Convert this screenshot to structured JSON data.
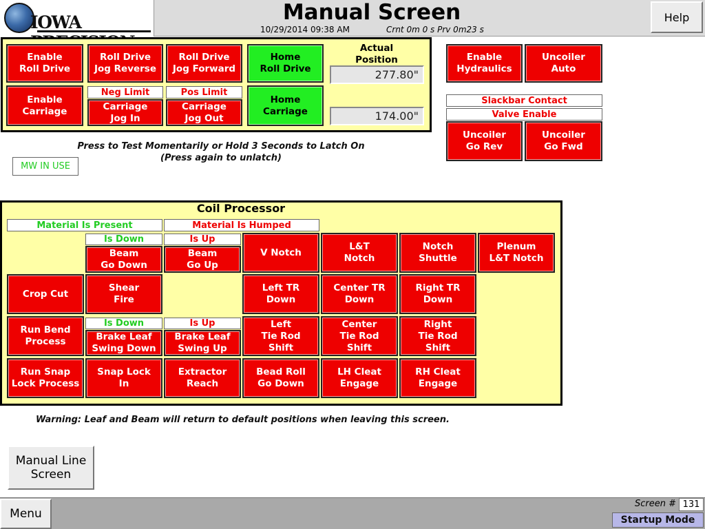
{
  "header": {
    "title": "Manual Screen",
    "datetime": "10/29/2014 09:38 AM",
    "timers": "Crnt  0m  0 s  Prv  0m23 s",
    "help_label": "Help",
    "logo_text": "IOWA PRECISION"
  },
  "top_panel": {
    "enable_roll_drive": "Enable\nRoll Drive",
    "roll_drive_jog_reverse": "Roll Drive\nJog Reverse",
    "roll_drive_jog_forward": "Roll Drive\nJog Forward",
    "home_roll_drive": "Home\nRoll Drive",
    "actual_position_label": "Actual\nPosition",
    "position_1": "277.80\"",
    "enable_carriage": "Enable\nCarriage",
    "neg_limit": "Neg Limit",
    "pos_limit": "Pos Limit",
    "carriage_jog_in": "Carriage\nJog In",
    "carriage_jog_out": "Carriage\nJog Out",
    "home_carriage": "Home\nCarriage",
    "position_2": "174.00\""
  },
  "right_panel": {
    "enable_hydraulics": "Enable\nHydraulics",
    "uncoiler_auto": "Uncoiler\nAuto",
    "slackbar_contact": "Slackbar Contact",
    "valve_enable": "Valve Enable",
    "uncoiler_go_rev": "Uncoiler\nGo Rev",
    "uncoiler_go_fwd": "Uncoiler\nGo Fwd"
  },
  "instructions": {
    "line1": "Press to Test Momentarily or Hold 3 Seconds to Latch On",
    "line2": "(Press again to unlatch)",
    "mw_in_use": "MW IN USE"
  },
  "coil_processor": {
    "title": "Coil Processor",
    "material_present": "Material Is Present",
    "material_humped": "Material Is Humped",
    "beam_is_down": "Is Down",
    "beam_is_up": "Is Up",
    "beam_go_down": "Beam\nGo Down",
    "beam_go_up": "Beam\nGo Up",
    "v_notch": "V Notch",
    "lt_notch": "L&T\nNotch",
    "notch_shuttle": "Notch\nShuttle",
    "plenum_lt_notch": "Plenum\nL&T Notch",
    "crop_cut": "Crop Cut",
    "shear_fire": "Shear\nFire",
    "left_tr_down": "Left TR\nDown",
    "center_tr_down": "Center TR\nDown",
    "right_tr_down": "Right TR\nDown",
    "run_bend_process": "Run Bend\nProcess",
    "leaf_is_down": "Is Down",
    "leaf_is_up": "Is Up",
    "brake_leaf_swing_down": "Brake Leaf\nSwing Down",
    "brake_leaf_swing_up": "Brake Leaf\nSwing Up",
    "left_tie_rod_shift": "Left\nTie Rod\nShift",
    "center_tie_rod_shift": "Center\nTie Rod\nShift",
    "right_tie_rod_shift": "Right\nTie Rod\nShift",
    "run_snap_lock_process": "Run Snap\nLock Process",
    "snap_lock_in": "Snap Lock\nIn",
    "extractor_reach": "Extractor\nReach",
    "bead_roll_go_down": "Bead Roll\nGo Down",
    "lh_cleat_engage": "LH Cleat\nEngage",
    "rh_cleat_engage": "RH Cleat\nEngage"
  },
  "warning": "Warning: Leaf and Beam will return to default positions when leaving this screen.",
  "manual_line_label": "Manual Line\nScreen",
  "footer": {
    "menu_label": "Menu",
    "screen_label": "Screen #",
    "screen_number": "131",
    "mode": "Startup Mode"
  },
  "colors": {
    "button_red": "#ee0000",
    "button_green": "#22ee22",
    "panel_yellow": "#ffffa6",
    "status_green": "#22cc22"
  }
}
